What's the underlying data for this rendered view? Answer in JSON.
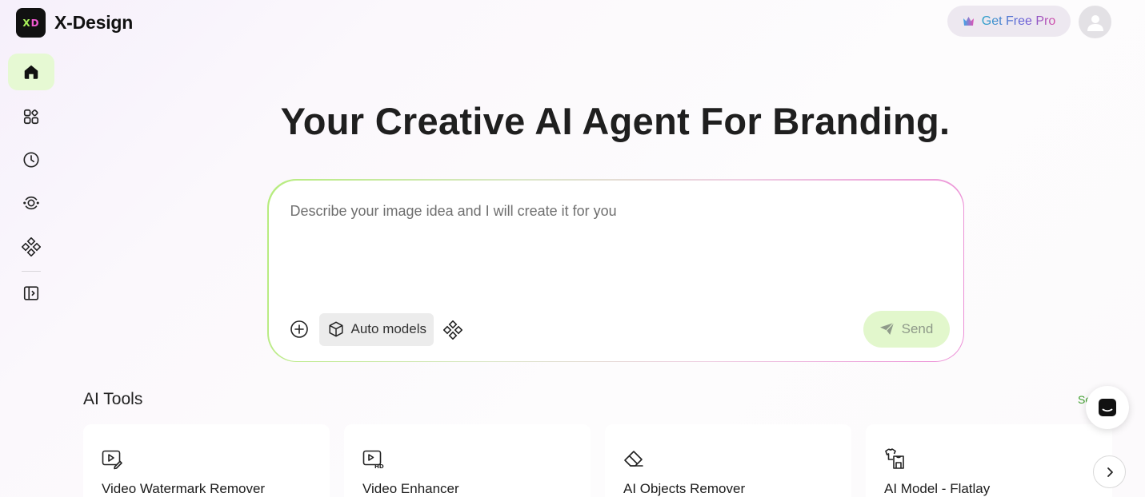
{
  "header": {
    "brand": "X-Design",
    "logo_left": "X",
    "logo_right": "D",
    "pro_label": "Get Free Pro"
  },
  "sidebar": {
    "items": [
      {
        "icon": "home-icon",
        "active": true
      },
      {
        "icon": "grid-icon",
        "active": false
      },
      {
        "icon": "clock-icon",
        "active": false
      },
      {
        "icon": "scan-icon",
        "active": false
      },
      {
        "icon": "diamond-icon",
        "active": false
      },
      {
        "icon": "sidebar-expand-icon",
        "active": false
      }
    ]
  },
  "hero": {
    "title": "Your Creative AI Agent For Branding."
  },
  "prompt": {
    "placeholder": "Describe your image idea and I will create it for you",
    "value": "",
    "models_label": "Auto models",
    "send_label": "Send"
  },
  "tools": {
    "title": "AI Tools",
    "see_all": "See all",
    "cards": [
      {
        "name": "Video Watermark Remover",
        "icon": "video-edit-icon"
      },
      {
        "name": "Video Enhancer",
        "icon": "video-hd-icon"
      },
      {
        "name": "AI Objects Remover",
        "icon": "eraser-icon"
      },
      {
        "name": "AI Model - Flatlay",
        "icon": "shirt-icon"
      }
    ]
  },
  "colors": {
    "accent_green": "#e6f9d3",
    "send_bg": "#e2f7cc",
    "gradient_start": "#b6ec7d",
    "gradient_end": "#ec8dd6",
    "link_green": "#3f9f2e"
  }
}
